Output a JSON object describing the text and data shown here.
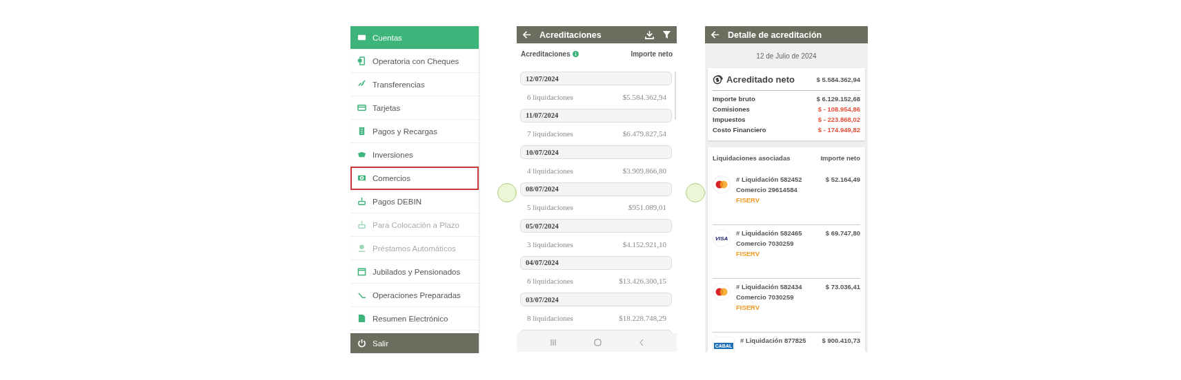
{
  "menu": {
    "items": [
      {
        "label": "Cuentas",
        "selected": true,
        "highlighted": false,
        "disabled": false
      },
      {
        "label": "Operatoria con Cheques",
        "selected": false,
        "highlighted": false,
        "disabled": false
      },
      {
        "label": "Transferencias",
        "selected": false,
        "highlighted": false,
        "disabled": false
      },
      {
        "label": "Tarjetas",
        "selected": false,
        "highlighted": false,
        "disabled": false
      },
      {
        "label": "Pagos y Recargas",
        "selected": false,
        "highlighted": false,
        "disabled": false
      },
      {
        "label": "Inversiones",
        "selected": false,
        "highlighted": false,
        "disabled": false
      },
      {
        "label": "Comercios",
        "selected": false,
        "highlighted": true,
        "disabled": false
      },
      {
        "label": "Pagos DEBIN",
        "selected": false,
        "highlighted": false,
        "disabled": false
      },
      {
        "label": "Para Colocación a Plazo",
        "selected": false,
        "highlighted": false,
        "disabled": true
      },
      {
        "label": "Préstamos Automáticos",
        "selected": false,
        "highlighted": false,
        "disabled": true
      },
      {
        "label": "Jubilados y Pensionados",
        "selected": false,
        "highlighted": false,
        "disabled": false
      },
      {
        "label": "Operaciones Preparadas",
        "selected": false,
        "highlighted": false,
        "disabled": false
      },
      {
        "label": "Resumen Electrónico",
        "selected": false,
        "highlighted": false,
        "disabled": false
      }
    ],
    "logout": "Salir"
  },
  "accreditations": {
    "title": "Acreditaciones",
    "column_1": "Acreditaciones",
    "column_2": "Importe neto",
    "groups": [
      {
        "date": "12/07/2024",
        "count": "6 liquidaciones",
        "amount": "$5.584.362,94"
      },
      {
        "date": "11/07/2024",
        "count": "7 liquidaciones",
        "amount": "$6.479.827,54"
      },
      {
        "date": "10/07/2024",
        "count": "4 liquidaciones",
        "amount": "$3.909.866,80"
      },
      {
        "date": "08/07/2024",
        "count": "5 liquidaciones",
        "amount": "$951.089,01"
      },
      {
        "date": "05/07/2024",
        "count": "3 liquidaciones",
        "amount": "$4.152.921,10"
      },
      {
        "date": "04/07/2024",
        "count": "6 liquidaciones",
        "amount": "$13.426.300,15"
      },
      {
        "date": "03/07/2024",
        "count": "8 liquidaciones",
        "amount": "$18.228.748,29"
      }
    ]
  },
  "detail": {
    "title": "Detalle de acreditación",
    "date": "12 de Julio de 2024",
    "summary": {
      "label": "Acreditado neto",
      "amount": "$ 5.584.362,94",
      "rows": [
        {
          "label": "Importe bruto",
          "amount": "$ 6.129.152,68",
          "negative": false
        },
        {
          "label": "Comisiones",
          "amount": "$ - 108.954,86",
          "negative": true
        },
        {
          "label": "Impuestos",
          "amount": "$ - 223.868,02",
          "negative": true
        },
        {
          "label": "Costo Financiero",
          "amount": "$ - 174.949,82",
          "negative": true
        }
      ]
    },
    "settlements": {
      "column_1": "Liquidaciones asociadas",
      "column_2": "Importe neto",
      "items": [
        {
          "kind": "mastercard",
          "liquidacion_label": "# Liquidación",
          "liquidacion": "582452",
          "amount": "$ 52.164,49",
          "comercio_label": "Comercio",
          "comercio": "29614584",
          "provider": "FISERV"
        },
        {
          "kind": "visa",
          "logo_text": "VISA",
          "liquidacion_label": "# Liquidación",
          "liquidacion": "582465",
          "amount": "$ 69.747,80",
          "comercio_label": "Comercio",
          "comercio": "7030259",
          "provider": "FISERV"
        },
        {
          "kind": "mastercard",
          "liquidacion_label": "# Liquidación",
          "liquidacion": "582434",
          "amount": "$ 73.036,41",
          "comercio_label": "Comercio",
          "comercio": "7030259",
          "provider": "FISERV"
        },
        {
          "kind": "cabal",
          "logo_text": "CABAL",
          "liquidacion_label": "# Liquidación",
          "liquidacion": "877825",
          "amount": "$ 900.410,73"
        }
      ]
    }
  }
}
